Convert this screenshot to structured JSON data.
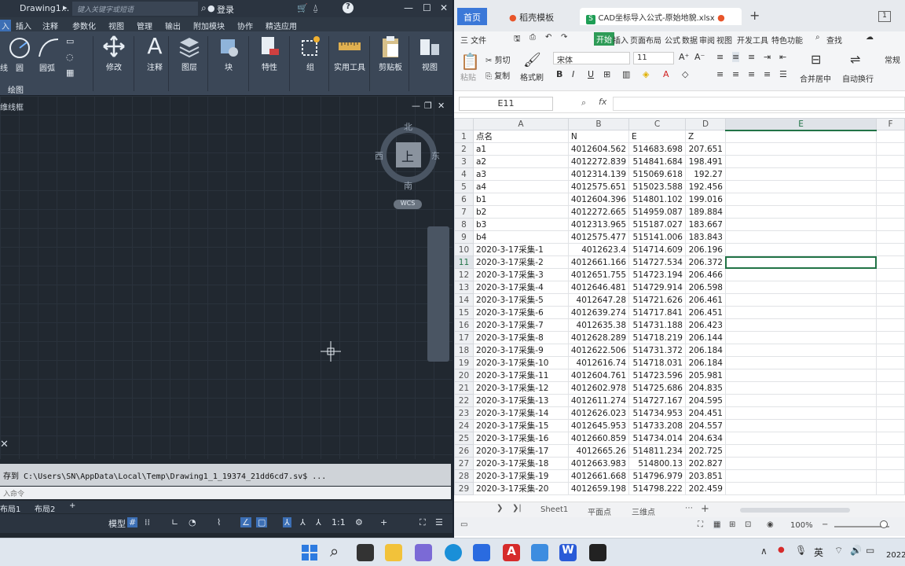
{
  "cad": {
    "title": "Drawing1...",
    "search_placeholder": "键入关键字或短语",
    "login": "登录",
    "menu": [
      "入",
      "插入",
      "注释",
      "参数化",
      "视图",
      "管理",
      "输出",
      "附加模块",
      "协作",
      "精选应用"
    ],
    "ribbon_left": {
      "line": "线",
      "circle": "圆",
      "arc": "圆弧",
      "panel": "绘图"
    },
    "ribbon_buttons": [
      "修改",
      "注释",
      "图层",
      "块",
      "特性",
      "组",
      "实用工具",
      "剪贴板",
      "视图"
    ],
    "viewport_label": "维线框",
    "compass": {
      "n": "北",
      "s": "南",
      "e": "东",
      "w": "西",
      "top": "上",
      "wcs": "WCS"
    },
    "cmd_history": "存到 C:\\Users\\SN\\AppData\\Local\\Temp\\Drawing1_1_19374_21dd6cd7.sv$ ...",
    "cmd_placeholder": "入命令",
    "layout_tabs": [
      "布局1",
      "布局2"
    ],
    "status": {
      "model": "模型",
      "scale": "1:1"
    }
  },
  "excel": {
    "tabs": [
      {
        "label": "首页"
      },
      {
        "label": "稻壳模板"
      },
      {
        "label": "CAD坐标导入公式-原始地貌.xlsx"
      }
    ],
    "menu": [
      "三 文件",
      "开始",
      "插入",
      "页面布局",
      "公式",
      "数据",
      "审阅",
      "视图",
      "开发工具",
      "特色功能",
      "查找"
    ],
    "ribbon": {
      "paste": "粘贴",
      "cut": "剪切",
      "copy": "复制",
      "format_painter": "格式刷",
      "font": "宋体",
      "size": "11",
      "merge": "合并居中",
      "wrap": "自动换行",
      "normal": "常规"
    },
    "name_box": "E11",
    "fx": "fx",
    "col_headers": [
      "",
      "A",
      "B",
      "C",
      "D",
      "E",
      "F"
    ],
    "rows": [
      [
        "1",
        "点名",
        "N",
        "E",
        "Z"
      ],
      [
        "2",
        "a1",
        "4012604.562",
        "514683.698",
        "207.651"
      ],
      [
        "3",
        "a2",
        "4012272.839",
        "514841.684",
        "198.491"
      ],
      [
        "4",
        "a3",
        "4012314.139",
        "515069.618",
        "192.27"
      ],
      [
        "5",
        "a4",
        "4012575.651",
        "515023.588",
        "192.456"
      ],
      [
        "6",
        "b1",
        "4012604.396",
        "514801.102",
        "199.016"
      ],
      [
        "7",
        "b2",
        "4012272.665",
        "514959.087",
        "189.884"
      ],
      [
        "8",
        "b3",
        "4012313.965",
        "515187.027",
        "183.667"
      ],
      [
        "9",
        "b4",
        "4012575.477",
        "515141.006",
        "183.843"
      ],
      [
        "10",
        "2020-3-17采集-1",
        "4012623.4",
        "514714.609",
        "206.196"
      ],
      [
        "11",
        "2020-3-17采集-2",
        "4012661.166",
        "514727.534",
        "206.372"
      ],
      [
        "12",
        "2020-3-17采集-3",
        "4012651.755",
        "514723.194",
        "206.466"
      ],
      [
        "13",
        "2020-3-17采集-4",
        "4012646.481",
        "514729.914",
        "206.598"
      ],
      [
        "14",
        "2020-3-17采集-5",
        "4012647.28",
        "514721.626",
        "206.461"
      ],
      [
        "15",
        "2020-3-17采集-6",
        "4012639.274",
        "514717.841",
        "206.451"
      ],
      [
        "16",
        "2020-3-17采集-7",
        "4012635.38",
        "514731.188",
        "206.423"
      ],
      [
        "17",
        "2020-3-17采集-8",
        "4012628.289",
        "514718.219",
        "206.144"
      ],
      [
        "18",
        "2020-3-17采集-9",
        "4012622.506",
        "514731.372",
        "206.184"
      ],
      [
        "19",
        "2020-3-17采集-10",
        "4012616.74",
        "514718.031",
        "206.184"
      ],
      [
        "20",
        "2020-3-17采集-11",
        "4012604.761",
        "514723.596",
        "205.981"
      ],
      [
        "21",
        "2020-3-17采集-12",
        "4012602.978",
        "514725.686",
        "204.835"
      ],
      [
        "22",
        "2020-3-17采集-13",
        "4012611.274",
        "514727.167",
        "204.595"
      ],
      [
        "23",
        "2020-3-17采集-14",
        "4012626.023",
        "514734.953",
        "204.451"
      ],
      [
        "24",
        "2020-3-17采集-15",
        "4012645.953",
        "514733.208",
        "204.557"
      ],
      [
        "25",
        "2020-3-17采集-16",
        "4012660.859",
        "514734.014",
        "204.634"
      ],
      [
        "26",
        "2020-3-17采集-17",
        "4012665.26",
        "514811.234",
        "202.725"
      ],
      [
        "27",
        "2020-3-17采集-18",
        "4012663.983",
        "514800.13",
        "202.827"
      ],
      [
        "28",
        "2020-3-17采集-19",
        "4012661.668",
        "514796.979",
        "203.851"
      ],
      [
        "29",
        "2020-3-17采集-20",
        "4012659.198",
        "514798.222",
        "202.459"
      ]
    ],
    "sheet_tabs": [
      "Sheet1",
      "平面点",
      "三维点"
    ],
    "zoom": "100%"
  },
  "taskbar": {
    "ime": "英",
    "year": "2022"
  }
}
